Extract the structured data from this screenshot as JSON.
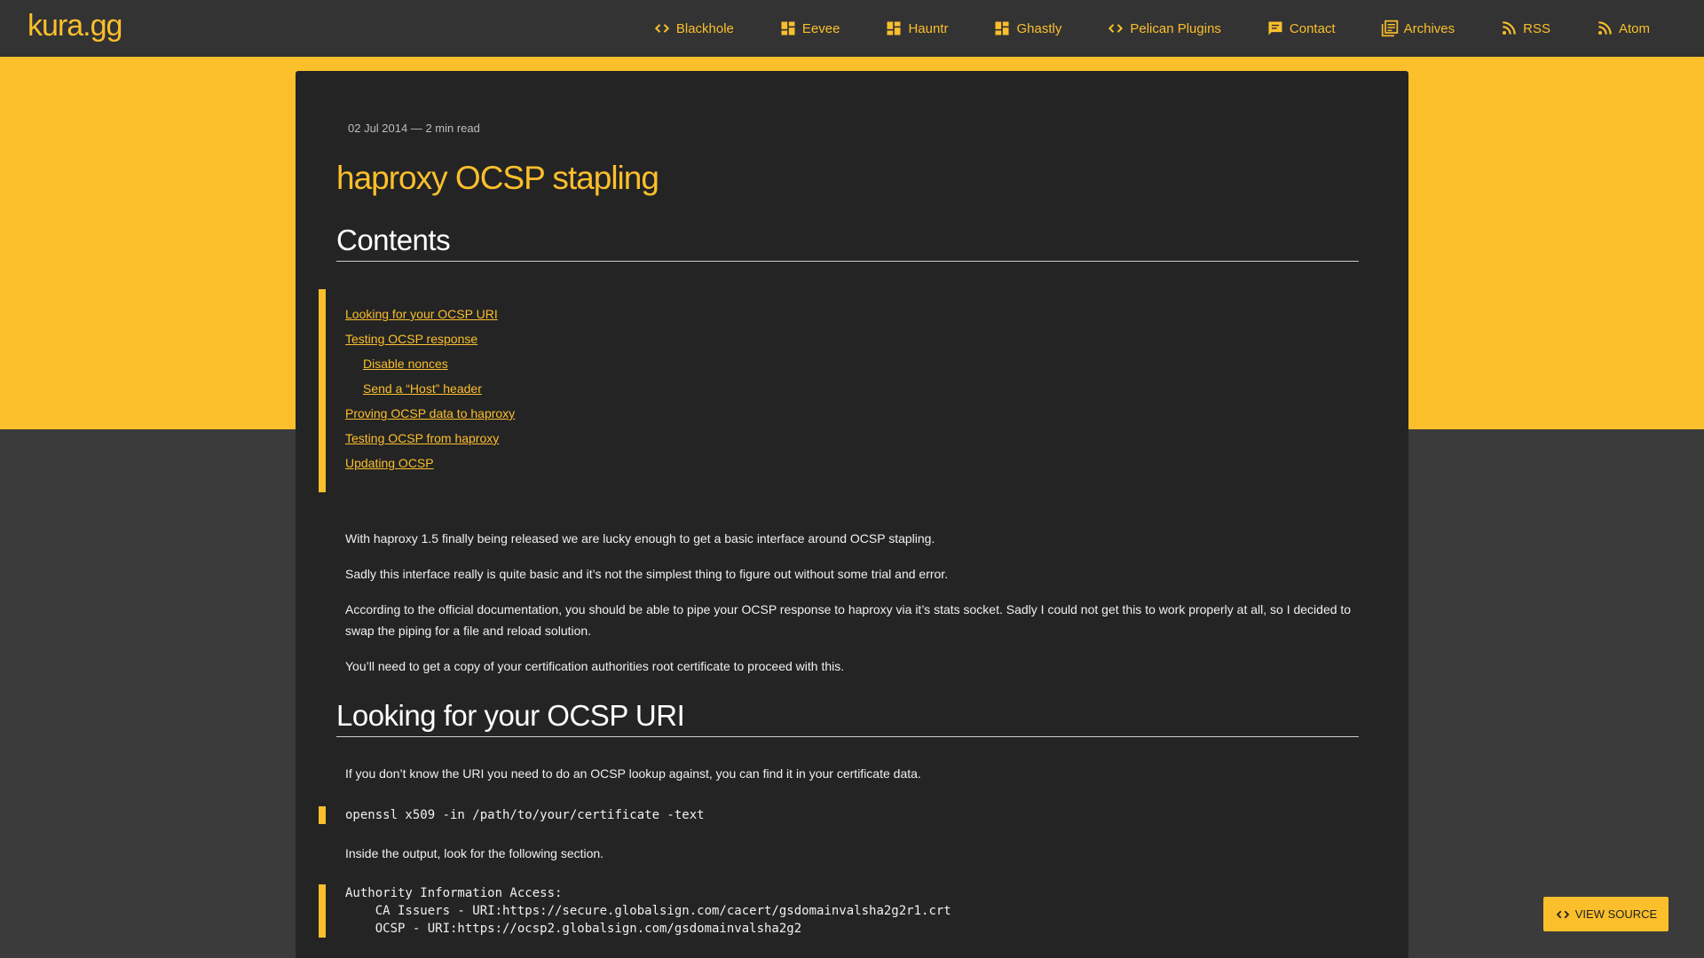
{
  "site": {
    "brand": "kura.gg"
  },
  "nav": [
    {
      "label": "Blackhole",
      "icon": "code-icon"
    },
    {
      "label": "Eevee",
      "icon": "dashboard-icon"
    },
    {
      "label": "Hauntr",
      "icon": "dashboard-icon"
    },
    {
      "label": "Ghastly",
      "icon": "dashboard-icon"
    },
    {
      "label": "Pelican Plugins",
      "icon": "code-icon"
    },
    {
      "label": "Contact",
      "icon": "chat-icon"
    },
    {
      "label": "Archives",
      "icon": "archive-icon"
    },
    {
      "label": "RSS",
      "icon": "rss-icon"
    },
    {
      "label": "Atom",
      "icon": "rss-icon"
    }
  ],
  "post": {
    "meta": "02 Jul 2014 — 2 min read",
    "title": "haproxy OCSP stapling"
  },
  "contents": {
    "heading": "Contents",
    "items": [
      "Looking for your OCSP URI",
      "Testing OCSP response",
      "Disable nonces",
      "Send a “Host” header",
      "Proving OCSP data to haproxy",
      "Testing OCSP from haproxy",
      "Updating OCSP"
    ]
  },
  "intro": {
    "p1": "With haproxy 1.5 finally being released we are lucky enough to get a basic interface around OCSP stapling.",
    "p2": "Sadly this interface really is quite basic and it’s not the simplest thing to figure out without some trial and error.",
    "p3": "According to the official documentation, you should be able to pipe your OCSP response to haproxy via it’s stats socket. Sadly I could not get this to work properly at all, so I decided to swap the piping for a file and reload solution.",
    "p4": "You’ll need to get a copy of your certification authorities root certificate to proceed with this."
  },
  "section1": {
    "heading": "Looking for your OCSP URI",
    "p1": "If you don’t know the URI you need to do an OCSP lookup against, you can find it in your certificate data.",
    "code1": "openssl x509 -in /path/to/your/certificate -text",
    "p2": "Inside the output, look for the following section.",
    "code2": "Authority Information Access:\n    CA Issuers - URI:https://secure.globalsign.com/cacert/gsdomainvalsha2g2r1.crt\n    OCSP - URI:https://ocsp2.globalsign.com/gsdomainvalsha2g2"
  },
  "view_source": {
    "label": "VIEW SOURCE"
  },
  "colors": {
    "accent": "#fbbf2c",
    "topbar": "#333333",
    "card": "#242424",
    "page": "#3b3b3b"
  }
}
